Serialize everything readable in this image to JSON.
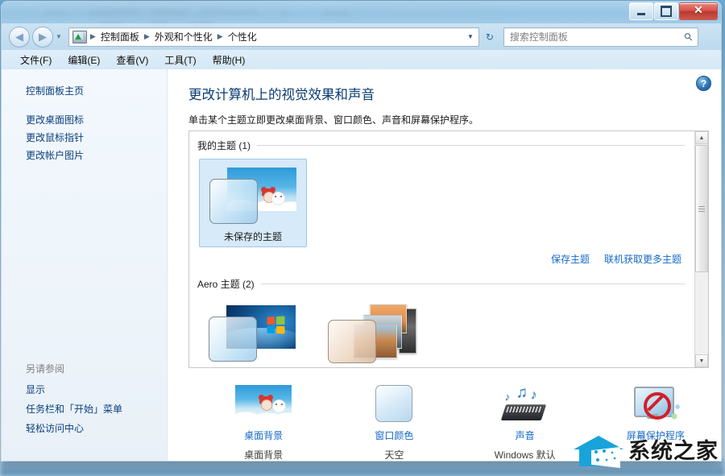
{
  "window": {
    "title": "",
    "controls": {
      "minimize": "最小化",
      "maximize": "最大化",
      "close": "✕"
    }
  },
  "navbar": {
    "back": "◀",
    "forward": "▶",
    "history_caret": "▼",
    "breadcrumb": {
      "icon": "control-panel-icon",
      "items": [
        "控制面板",
        "外观和个性化",
        "个性化"
      ],
      "separator": "▶"
    },
    "address_caret": "▼",
    "refresh": "↻",
    "search": {
      "placeholder": "搜索控制面板",
      "value": "",
      "icon": "search-icon"
    }
  },
  "menubar": {
    "items": [
      "文件(F)",
      "编辑(E)",
      "查看(V)",
      "工具(T)",
      "帮助(H)"
    ]
  },
  "sidebar": {
    "home_link": "控制面板主页",
    "links": [
      "更改桌面图标",
      "更改鼠标指针",
      "更改帐户图片"
    ],
    "see_also": {
      "title": "另请参阅",
      "links": [
        "显示",
        "任务栏和「开始」菜单",
        "轻松访问中心"
      ]
    }
  },
  "content": {
    "help_icon": "?",
    "title": "更改计算机上的视觉效果和声音",
    "description": "单击某个主题立即更改桌面背景、窗口颜色、声音和屏幕保护程序。",
    "groups": [
      {
        "label": "我的主题 (1)",
        "themes": [
          {
            "name": "未保存的主题",
            "selected": true,
            "art": "unsaved-theme"
          }
        ]
      },
      {
        "label": "Aero 主题 (2)",
        "themes": [
          {
            "name": "",
            "selected": false,
            "art": "windows-7-theme"
          },
          {
            "name": "",
            "selected": false,
            "art": "landscape-theme"
          }
        ]
      }
    ],
    "panel_links": [
      "保存主题",
      "联机获取更多主题"
    ],
    "scrollbar": {
      "up_arrow": "▲",
      "down_arrow": "▼"
    }
  },
  "quick_items": [
    {
      "label": "桌面背景",
      "value": "桌面背景",
      "icon": "wallpaper-icon"
    },
    {
      "label": "窗口颜色",
      "value": "天空",
      "icon": "window-color-icon"
    },
    {
      "label": "声音",
      "value": "Windows 默认",
      "icon": "sound-icon"
    },
    {
      "label": "屏幕保护程序",
      "value": "",
      "icon": "screensaver-icon"
    }
  ],
  "watermark": {
    "text": "系统之家",
    "logo": "house-logo"
  },
  "colors": {
    "link": "#1569c7",
    "sidebar_link": "#0b3f7e",
    "title": "#0b3c72",
    "selected_tile": "#d6eaf9",
    "accent": "#19a3db"
  }
}
